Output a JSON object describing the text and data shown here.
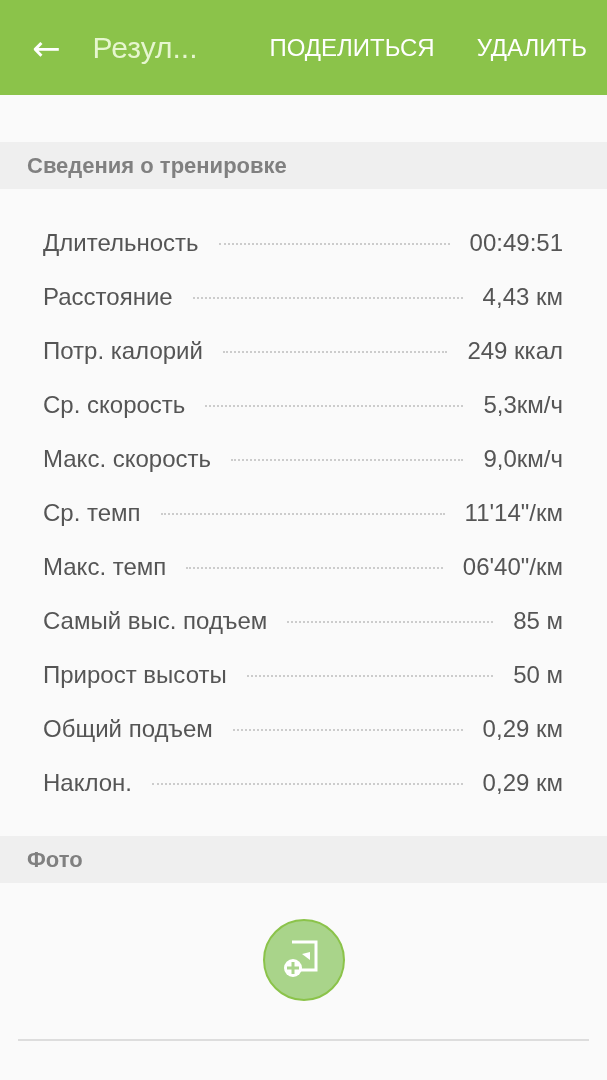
{
  "app_bar": {
    "back": "←",
    "title": "Резул...",
    "actions": [
      "ПОДЕЛИТЬСЯ",
      "УДАЛИТЬ"
    ]
  },
  "workout_section": {
    "title": "Сведения о тренировке",
    "stats": [
      {
        "label": "Длительность",
        "value": "00:49:51"
      },
      {
        "label": "Расстояние",
        "value": "4,43 км"
      },
      {
        "label": "Потр. калорий",
        "value": "249 ккал"
      },
      {
        "label": "Ср. скорость",
        "value": "5,3км/ч"
      },
      {
        "label": "Макс. скорость",
        "value": "9,0км/ч"
      },
      {
        "label": "Ср. темп",
        "value": "11'14\"/км"
      },
      {
        "label": "Макс. темп",
        "value": "06'40\"/км"
      },
      {
        "label": "Самый выс. подъем",
        "value": "85 м"
      },
      {
        "label": "Прирост высоты",
        "value": "50 м"
      },
      {
        "label": "Общий подъем",
        "value": "0,29 км"
      },
      {
        "label": "Наклон.",
        "value": "0,29 км"
      }
    ]
  },
  "photo_section": {
    "title": "Фото"
  }
}
